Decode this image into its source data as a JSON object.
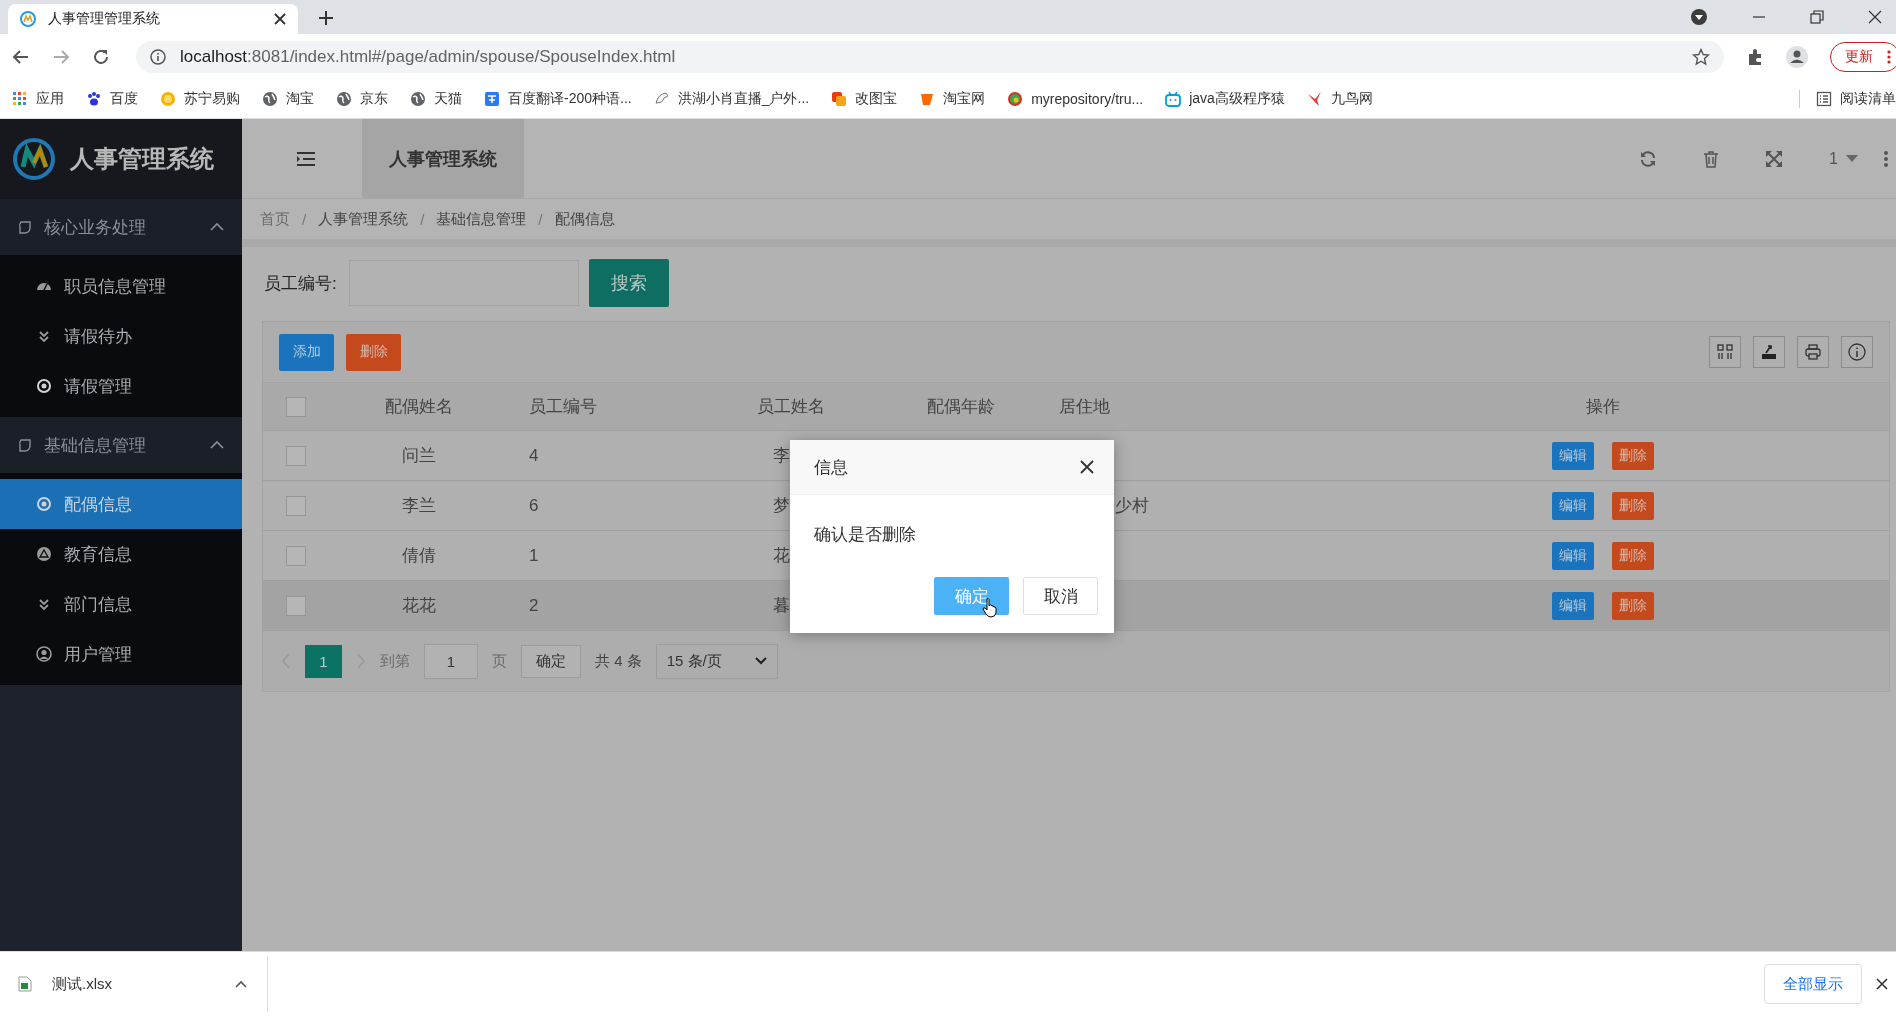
{
  "browser": {
    "tab_title": "人事管理管理系统",
    "url_host": "localhost",
    "url_rest": ":8081/index.html#/page/admin/spouse/SpouseIndex.html",
    "update_button": "更新",
    "reading_list": "阅读清单",
    "bookmarks": [
      {
        "kind": "apps",
        "label": "应用"
      },
      {
        "kind": "paw",
        "label": "百度"
      },
      {
        "kind": "sun",
        "label": "苏宁易购"
      },
      {
        "kind": "globe",
        "label": "淘宝"
      },
      {
        "kind": "globe",
        "label": "京东"
      },
      {
        "kind": "globe",
        "label": "天猫"
      },
      {
        "kind": "translate",
        "label": "百度翻译-200种语..."
      },
      {
        "kind": "bird",
        "label": "洪湖小肖直播_户外..."
      },
      {
        "kind": "squares",
        "label": "改图宝"
      },
      {
        "kind": "orange",
        "label": "淘宝网"
      },
      {
        "kind": "ring",
        "label": "myrepository/tru..."
      },
      {
        "kind": "tv",
        "label": "java高级程序猿"
      },
      {
        "kind": "swallow",
        "label": "九鸟网"
      }
    ]
  },
  "app": {
    "logo_title": "人事管理系统",
    "header_tab": "人事管理系统",
    "header_page": "1",
    "sidebar": [
      {
        "label": "核心业务处理",
        "expanded": true,
        "items": [
          {
            "kind": "gauge",
            "label": "职员信息管理",
            "selected": false
          },
          {
            "kind": "chevrons",
            "label": "请假待办",
            "selected": false
          },
          {
            "kind": "target",
            "label": "请假管理",
            "selected": false
          }
        ]
      },
      {
        "label": "基础信息管理",
        "expanded": true,
        "items": [
          {
            "kind": "target",
            "label": "配偶信息",
            "selected": true
          },
          {
            "kind": "triangle",
            "label": "教育信息",
            "selected": false
          },
          {
            "kind": "chevrons",
            "label": "部门信息",
            "selected": false
          },
          {
            "kind": "user",
            "label": "用户管理",
            "selected": false
          }
        ]
      }
    ],
    "breadcrumb": {
      "separator": "/",
      "items": [
        "首页",
        "人事管理系统",
        "基础信息管理",
        "配偶信息"
      ]
    },
    "search": {
      "label": "员工编号:",
      "button": "搜索"
    },
    "toolbar": {
      "add": "添加",
      "delete": "删除"
    },
    "table": {
      "select_all_checked": false,
      "columns": [
        "配偶姓名",
        "员工编号",
        "员工姓名",
        "配偶年龄",
        "居住地",
        "操作"
      ],
      "rows": [
        {
          "checked": false,
          "highlighted": false,
          "spouse_name": "问兰",
          "employee_no": "4",
          "employee_name": "李",
          "edit": "编辑",
          "delete": "删除"
        },
        {
          "checked": false,
          "highlighted": false,
          "spouse_name": "李兰",
          "employee_no": "6",
          "employee_name": "梦",
          "residence": "少村",
          "edit": "编辑",
          "delete": "删除"
        },
        {
          "checked": false,
          "highlighted": false,
          "spouse_name": "倩倩",
          "employee_no": "1",
          "employee_name": "花",
          "edit": "编辑",
          "delete": "删除"
        },
        {
          "checked": false,
          "highlighted": true,
          "spouse_name": "花花",
          "employee_no": "2",
          "employee_name": "暮",
          "edit": "编辑",
          "delete": "删除"
        }
      ]
    },
    "pagination": {
      "pages": [
        {
          "label": "1",
          "selected": true
        }
      ],
      "goto_label": "到第",
      "goto_value": "1",
      "page_unit": "页",
      "confirm": "确定",
      "total": "共 4 条",
      "page_size": "15 条/页"
    },
    "dialog": {
      "title": "信息",
      "message": "确认是否删除",
      "confirm": "确定",
      "cancel": "取消"
    }
  },
  "downloads": {
    "file": "测试.xlsx",
    "show_all": "全部显示"
  }
}
